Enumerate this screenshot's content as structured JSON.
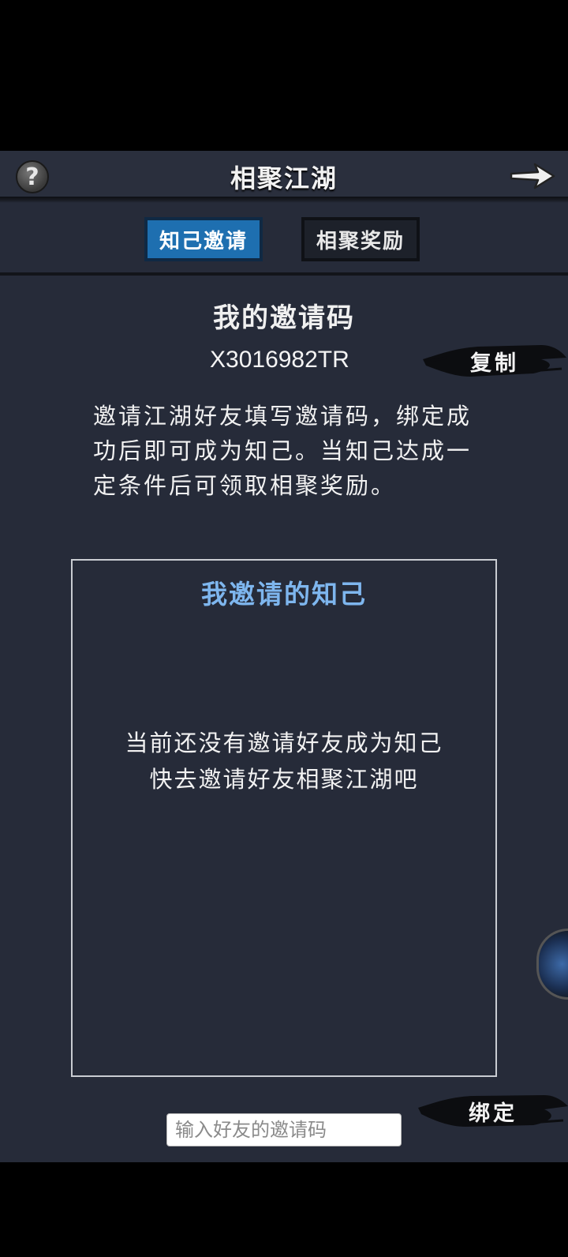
{
  "header": {
    "title": "相聚江湖",
    "help_icon": "question-mark-icon",
    "help_glyph": "?",
    "next_icon": "arrow-right-icon"
  },
  "tabs": [
    {
      "label": "知己邀请",
      "active": true
    },
    {
      "label": "相聚奖励",
      "active": false
    }
  ],
  "my_code": {
    "title": "我的邀请码",
    "value": "X3016982TR",
    "copy_label": "复制"
  },
  "description": "邀请江湖好友填写邀请码，绑定成功后即可成为知己。当知己达成一定条件后可领取相聚奖励。",
  "friends_panel": {
    "title": "我邀请的知己",
    "empty_line1": "当前还没有邀请好友成为知己",
    "empty_line2": "快去邀请好友相聚江湖吧"
  },
  "bind": {
    "input_value": "",
    "input_placeholder": "输入好友的邀请码",
    "bind_label": "绑定"
  },
  "colors": {
    "background": "#262b39",
    "active_tab": "#1e6fb0",
    "panel_title": "#7eb6ee"
  }
}
